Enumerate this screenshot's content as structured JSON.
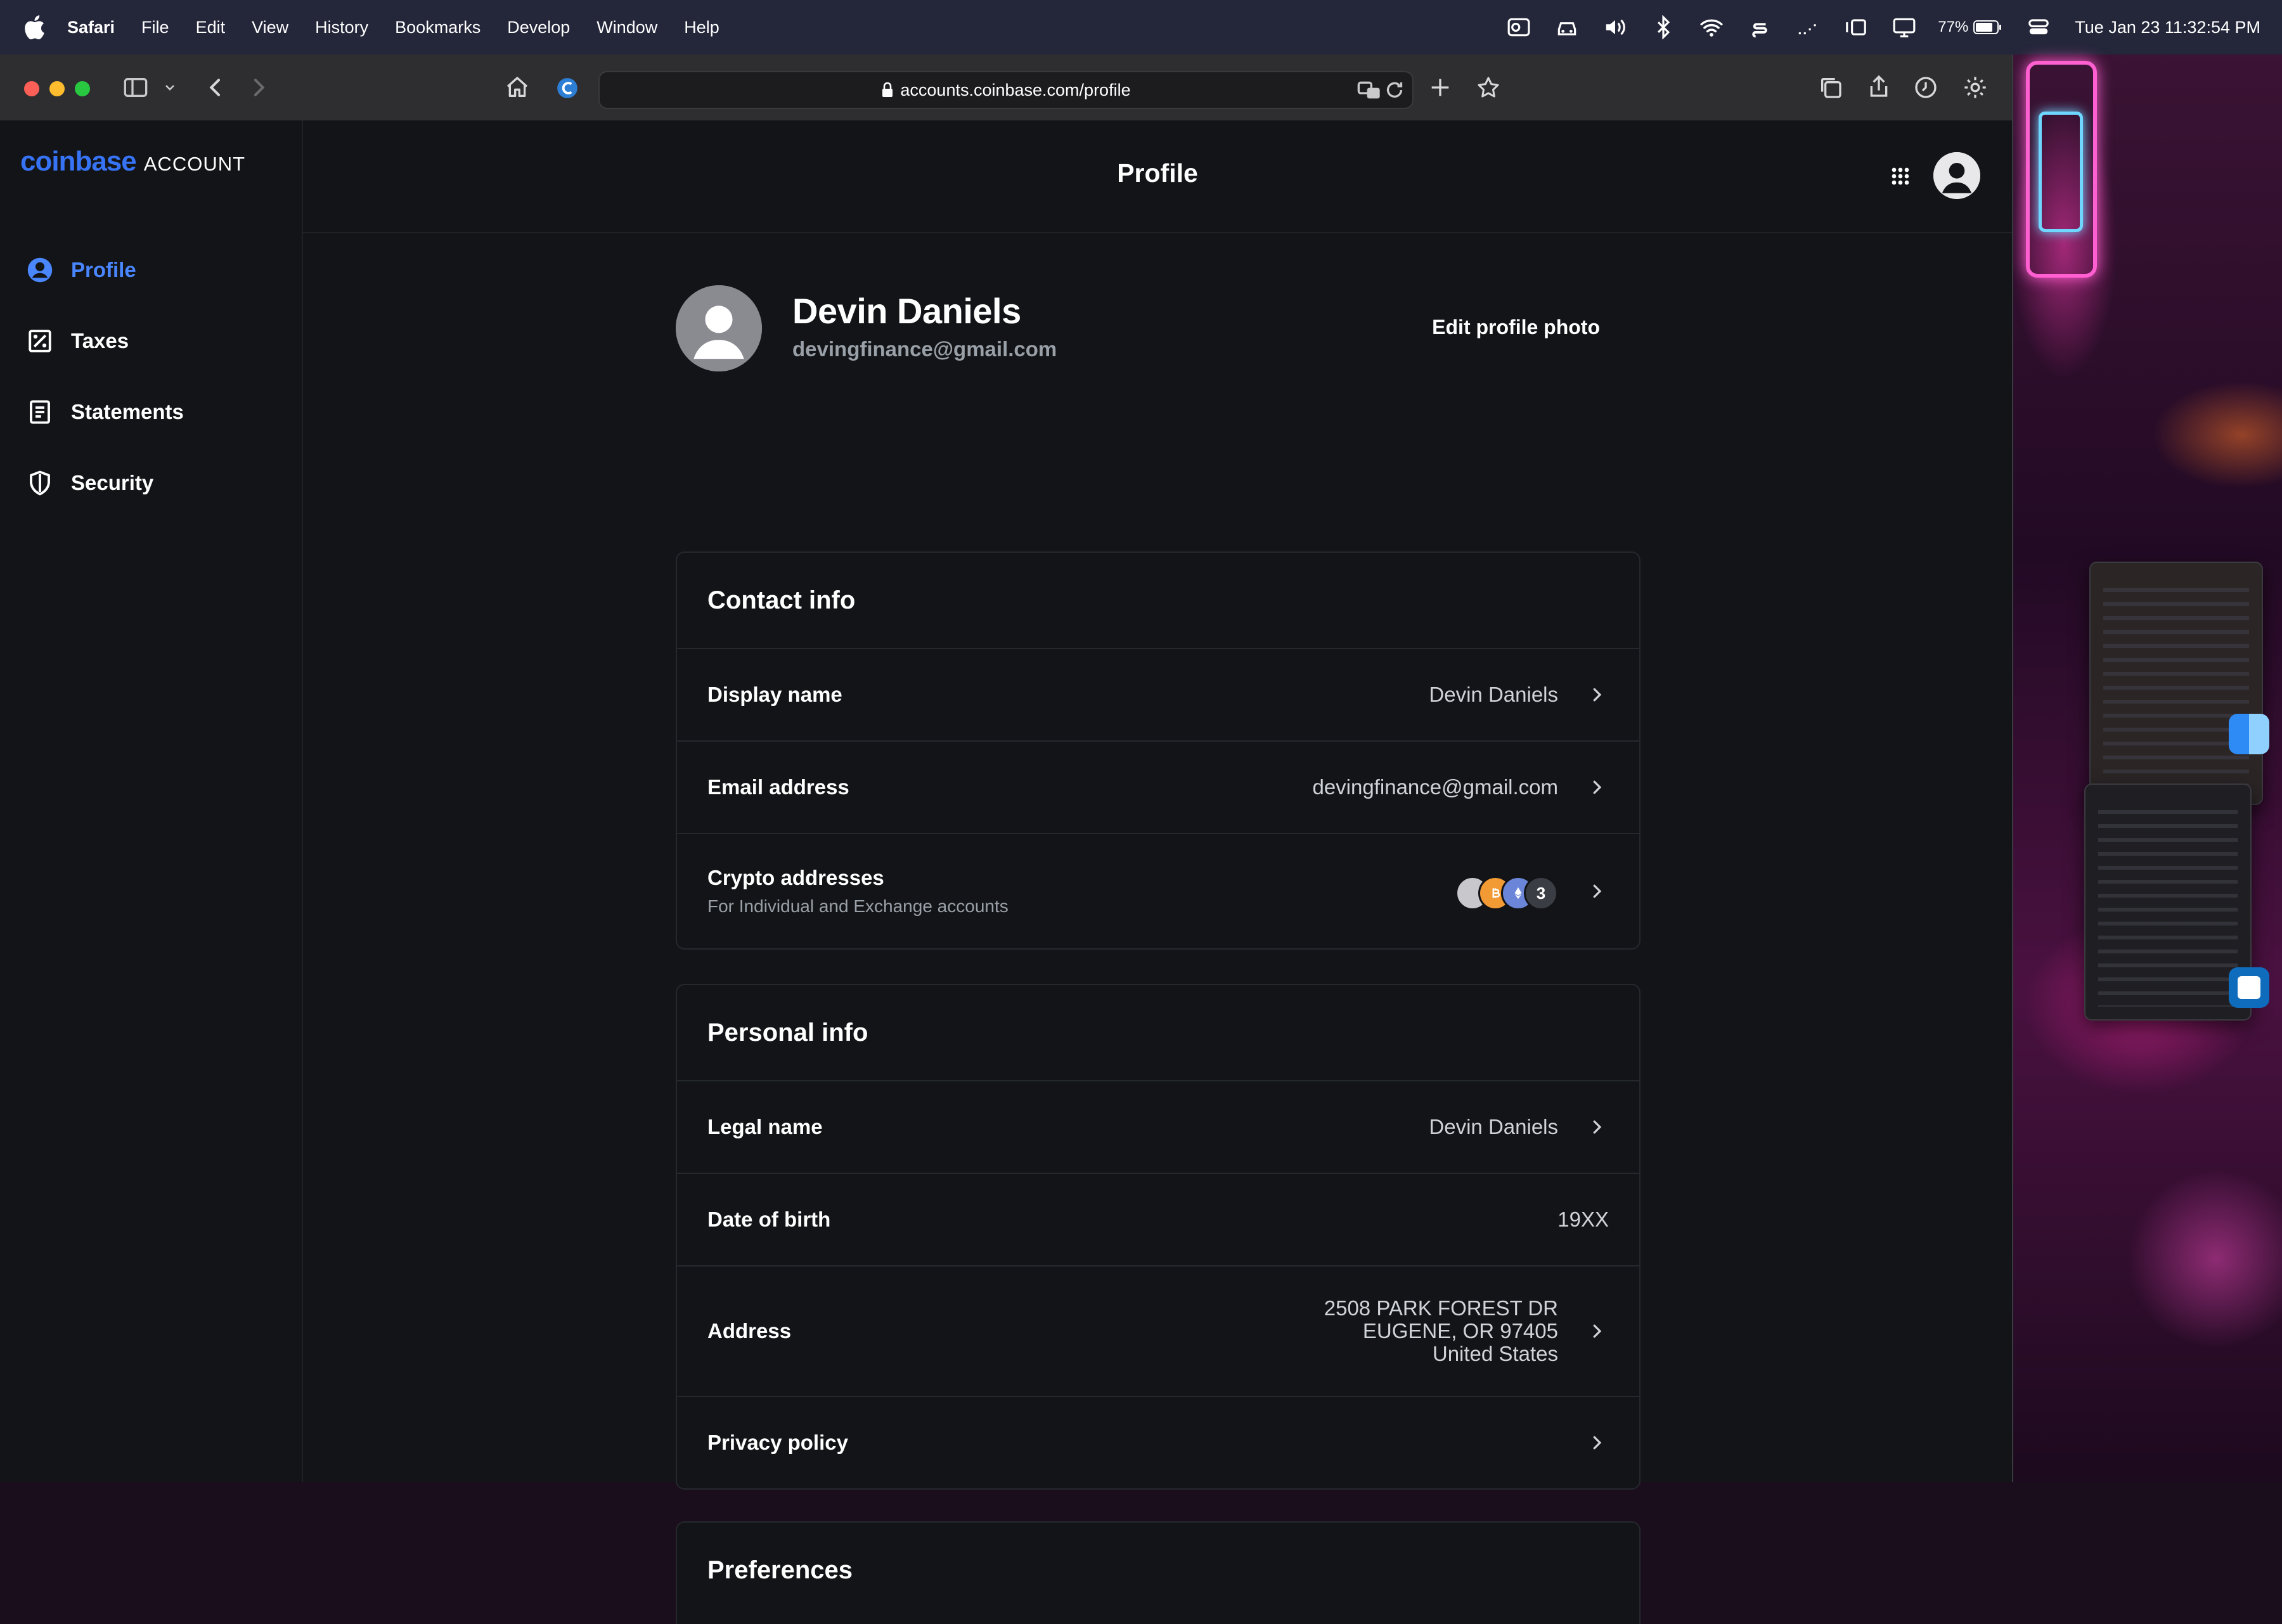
{
  "menubar": {
    "app": "Safari",
    "items": [
      "File",
      "Edit",
      "View",
      "History",
      "Bookmarks",
      "Develop",
      "Window",
      "Help"
    ],
    "battery_percent": "77%",
    "datetime": "Tue Jan 23  11:32:54 PM"
  },
  "browser": {
    "url": "accounts.coinbase.com/profile"
  },
  "brand": {
    "logo": "coinbase",
    "suffix": "ACCOUNT",
    "color": "#3773f5"
  },
  "sidebar": {
    "items": [
      {
        "label": "Profile",
        "icon": "user-circle-icon",
        "active": true
      },
      {
        "label": "Taxes",
        "icon": "taxes-icon",
        "active": false
      },
      {
        "label": "Statements",
        "icon": "document-icon",
        "active": false
      },
      {
        "label": "Security",
        "icon": "shield-icon",
        "active": false
      }
    ]
  },
  "header": {
    "title": "Profile"
  },
  "profile": {
    "name": "Devin Daniels",
    "email": "devingfinance@gmail.com",
    "edit_photo_label": "Edit profile photo"
  },
  "contact_info": {
    "title": "Contact info",
    "display_name": {
      "label": "Display name",
      "value": "Devin Daniels"
    },
    "email_address": {
      "label": "Email address",
      "value": "devingfinance@gmail.com"
    },
    "crypto_addresses": {
      "label": "Crypto addresses",
      "sublabel": "For Individual and Exchange accounts",
      "coins": [],
      "count": "3"
    }
  },
  "personal_info": {
    "title": "Personal info",
    "legal_name": {
      "label": "Legal name",
      "value": "Devin Daniels"
    },
    "date_of_birth": {
      "label": "Date of birth",
      "value": "19XX"
    },
    "address": {
      "label": "Address",
      "line1": "2508 PARK FOREST DR",
      "line2": "EUGENE, OR 97405",
      "line3": "United States"
    },
    "privacy_policy": {
      "label": "Privacy policy"
    }
  },
  "preferences": {
    "title": "Preferences"
  }
}
